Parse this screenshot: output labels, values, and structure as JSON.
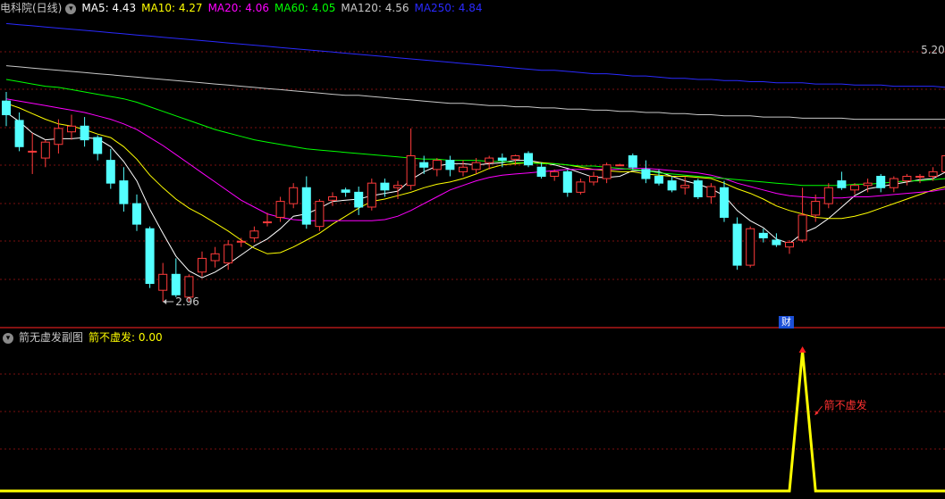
{
  "main_header": {
    "title": "电科院(日线)",
    "ma_items": [
      {
        "label": "MA5: 4.43",
        "color": "#ffffff"
      },
      {
        "label": "MA10: 4.27",
        "color": "#ffff00"
      },
      {
        "label": "MA20: 4.06",
        "color": "#ff00ff"
      },
      {
        "label": "MA60: 4.05",
        "color": "#00ff00"
      },
      {
        "label": "MA120: 4.56",
        "color": "#c8c8c8"
      },
      {
        "label": "MA250: 4.84",
        "color": "#2a2aff"
      }
    ]
  },
  "sub_header": {
    "title": "箭无虚发副图",
    "value_label": "箭不虚发: 0.00",
    "value_color": "#ffff00"
  },
  "annotations": {
    "high_label": "5.20",
    "low_label": "2.96",
    "cai_badge": "财",
    "signal_label": "箭不虚发"
  },
  "colors": {
    "background": "#000000",
    "up": "#ff3b3b",
    "down": "#54ffff",
    "grid": "#7a1010",
    "separator": "#b01818",
    "signal_line": "#ffff00",
    "signal_label": "#ff3030"
  },
  "chart_data": [
    {
      "type": "candlestick",
      "title": "电科院(日线)",
      "ylim": [
        2.85,
        5.45
      ],
      "ohlc": [
        [
          4.72,
          4.8,
          4.5,
          4.6
        ],
        [
          4.55,
          4.62,
          4.28,
          4.32
        ],
        [
          4.28,
          4.44,
          4.08,
          4.28
        ],
        [
          4.22,
          4.38,
          4.14,
          4.36
        ],
        [
          4.34,
          4.56,
          4.26,
          4.48
        ],
        [
          4.45,
          4.6,
          4.38,
          4.5
        ],
        [
          4.5,
          4.58,
          4.32,
          4.38
        ],
        [
          4.4,
          4.42,
          4.2,
          4.26
        ],
        [
          4.2,
          4.3,
          3.95,
          4.0
        ],
        [
          4.02,
          4.14,
          3.75,
          3.82
        ],
        [
          3.82,
          3.9,
          3.58,
          3.64
        ],
        [
          3.6,
          3.62,
          3.08,
          3.12
        ],
        [
          3.06,
          3.3,
          2.96,
          3.2
        ],
        [
          3.2,
          3.34,
          3.0,
          3.02
        ],
        [
          3.0,
          3.2,
          2.96,
          3.18
        ],
        [
          3.22,
          3.4,
          3.18,
          3.34
        ],
        [
          3.32,
          3.44,
          3.26,
          3.38
        ],
        [
          3.3,
          3.5,
          3.24,
          3.46
        ],
        [
          3.49,
          3.52,
          3.44,
          3.49
        ],
        [
          3.52,
          3.62,
          3.48,
          3.58
        ],
        [
          3.66,
          3.74,
          3.62,
          3.66
        ],
        [
          3.7,
          3.88,
          3.66,
          3.84
        ],
        [
          3.82,
          4.0,
          3.78,
          3.96
        ],
        [
          3.96,
          4.06,
          3.6,
          3.64
        ],
        [
          3.62,
          3.86,
          3.58,
          3.84
        ],
        [
          3.85,
          3.92,
          3.8,
          3.88
        ],
        [
          3.94,
          3.96,
          3.88,
          3.92
        ],
        [
          3.92,
          3.97,
          3.72,
          3.79
        ],
        [
          3.79,
          4.04,
          3.76,
          4.0
        ],
        [
          4.0,
          4.04,
          3.88,
          3.94
        ],
        [
          3.96,
          4.02,
          3.86,
          3.98
        ],
        [
          3.98,
          4.48,
          3.94,
          4.24
        ],
        [
          4.18,
          4.24,
          4.08,
          4.14
        ],
        [
          4.12,
          4.22,
          4.06,
          4.2
        ],
        [
          4.2,
          4.24,
          4.06,
          4.12
        ],
        [
          4.1,
          4.2,
          4.06,
          4.14
        ],
        [
          4.12,
          4.22,
          4.08,
          4.18
        ],
        [
          4.18,
          4.24,
          4.12,
          4.22
        ],
        [
          4.22,
          4.26,
          4.14,
          4.2
        ],
        [
          4.21,
          4.25,
          4.16,
          4.24
        ],
        [
          4.26,
          4.28,
          4.14,
          4.16
        ],
        [
          4.14,
          4.18,
          4.04,
          4.06
        ],
        [
          4.06,
          4.12,
          4.02,
          4.1
        ],
        [
          4.1,
          4.12,
          3.88,
          3.92
        ],
        [
          3.92,
          4.04,
          3.9,
          4.01
        ],
        [
          4.01,
          4.1,
          3.98,
          4.06
        ],
        [
          4.04,
          4.18,
          4.0,
          4.16
        ],
        [
          4.16,
          4.17,
          4.15,
          4.16
        ],
        [
          4.24,
          4.26,
          4.12,
          4.14
        ],
        [
          4.12,
          4.2,
          4.0,
          4.04
        ],
        [
          4.06,
          4.12,
          3.98,
          4.0
        ],
        [
          4.02,
          4.06,
          3.92,
          3.94
        ],
        [
          3.96,
          4.06,
          3.9,
          3.98
        ],
        [
          4.02,
          4.04,
          3.86,
          3.88
        ],
        [
          3.88,
          4.0,
          3.82,
          3.97
        ],
        [
          3.96,
          4.02,
          3.66,
          3.7
        ],
        [
          3.64,
          3.7,
          3.24,
          3.28
        ],
        [
          3.28,
          3.62,
          3.26,
          3.6
        ],
        [
          3.56,
          3.6,
          3.48,
          3.52
        ],
        [
          3.5,
          3.56,
          3.44,
          3.46
        ],
        [
          3.44,
          3.5,
          3.38,
          3.48
        ],
        [
          3.5,
          3.96,
          3.48,
          3.72
        ],
        [
          3.72,
          3.9,
          3.66,
          3.84
        ],
        [
          3.82,
          4.0,
          3.78,
          3.96
        ],
        [
          4.02,
          4.1,
          3.94,
          3.96
        ],
        [
          3.94,
          4.0,
          3.9,
          3.98
        ],
        [
          3.98,
          4.04,
          3.92,
          4.0
        ],
        [
          4.06,
          4.08,
          3.92,
          3.96
        ],
        [
          3.96,
          4.06,
          3.92,
          4.04
        ],
        [
          4.02,
          4.08,
          3.98,
          4.06
        ],
        [
          4.06,
          4.08,
          4.0,
          4.06
        ],
        [
          4.06,
          4.14,
          4.02,
          4.1
        ],
        [
          4.1,
          4.3,
          4.08,
          4.24
        ],
        [
          4.26,
          5.2,
          4.22,
          4.92
        ]
      ],
      "ma_series": {
        "MA5": [
          4.62,
          4.54,
          4.44,
          4.38,
          4.39,
          4.39,
          4.4,
          4.39,
          4.32,
          4.19,
          4.02,
          3.77,
          3.56,
          3.36,
          3.23,
          3.17,
          3.22,
          3.29,
          3.37,
          3.45,
          3.51,
          3.6,
          3.71,
          3.73,
          3.78,
          3.84,
          3.85,
          3.86,
          3.89,
          3.91,
          3.93,
          4.03,
          4.1,
          4.15,
          4.17,
          4.17,
          4.16,
          4.17,
          4.18,
          4.2,
          4.2,
          4.18,
          4.16,
          4.13,
          4.09,
          4.05,
          4.05,
          4.06,
          4.11,
          4.11,
          4.1,
          4.06,
          4.02,
          3.99,
          3.95,
          3.89,
          3.76,
          3.67,
          3.61,
          3.51,
          3.47,
          3.56,
          3.61,
          3.69,
          3.79,
          3.89,
          3.95,
          3.97,
          3.99,
          4.01,
          4.03,
          4.04,
          4.1,
          4.26
        ],
        "MA10": [
          4.7,
          4.66,
          4.61,
          4.56,
          4.52,
          4.5,
          4.47,
          4.43,
          4.4,
          4.32,
          4.21,
          4.07,
          3.96,
          3.86,
          3.78,
          3.72,
          3.65,
          3.58,
          3.5,
          3.43,
          3.38,
          3.39,
          3.44,
          3.5,
          3.56,
          3.64,
          3.71,
          3.78,
          3.84,
          3.86,
          3.89,
          3.92,
          3.96,
          3.99,
          4.01,
          4.04,
          4.08,
          4.13,
          4.16,
          4.17,
          4.18,
          4.18,
          4.17,
          4.16,
          4.14,
          4.12,
          4.11,
          4.1,
          4.1,
          4.08,
          4.07,
          4.06,
          4.06,
          4.05,
          4.04,
          4.0,
          3.95,
          3.91,
          3.86,
          3.8,
          3.76,
          3.73,
          3.7,
          3.69,
          3.69,
          3.71,
          3.74,
          3.78,
          3.82,
          3.86,
          3.9,
          3.94,
          3.97,
          4.02
        ],
        "MA20": [
          4.74,
          4.72,
          4.7,
          4.68,
          4.66,
          4.64,
          4.62,
          4.59,
          4.56,
          4.52,
          4.47,
          4.4,
          4.33,
          4.25,
          4.17,
          4.09,
          4.01,
          3.93,
          3.85,
          3.79,
          3.73,
          3.7,
          3.68,
          3.67,
          3.67,
          3.67,
          3.67,
          3.67,
          3.67,
          3.68,
          3.71,
          3.76,
          3.82,
          3.88,
          3.94,
          3.98,
          4.02,
          4.05,
          4.07,
          4.08,
          4.09,
          4.1,
          4.11,
          4.12,
          4.12,
          4.12,
          4.12,
          4.12,
          4.13,
          4.13,
          4.12,
          4.11,
          4.1,
          4.09,
          4.07,
          4.04,
          4.0,
          3.97,
          3.94,
          3.91,
          3.89,
          3.88,
          3.87,
          3.87,
          3.87,
          3.88,
          3.88,
          3.89,
          3.9,
          3.91,
          3.92,
          3.93,
          3.95,
          3.98
        ],
        "MA60": [
          4.91,
          4.89,
          4.87,
          4.85,
          4.84,
          4.82,
          4.8,
          4.78,
          4.76,
          4.74,
          4.71,
          4.67,
          4.63,
          4.59,
          4.55,
          4.51,
          4.47,
          4.44,
          4.41,
          4.38,
          4.36,
          4.34,
          4.32,
          4.3,
          4.29,
          4.28,
          4.27,
          4.26,
          4.25,
          4.24,
          4.23,
          4.22,
          4.21,
          4.21,
          4.2,
          4.2,
          4.2,
          4.19,
          4.19,
          4.18,
          4.18,
          4.17,
          4.17,
          4.16,
          4.15,
          4.15,
          4.14,
          4.13,
          4.12,
          4.11,
          4.09,
          4.08,
          4.07,
          4.06,
          4.05,
          4.04,
          4.03,
          4.02,
          4.01,
          4.0,
          3.99,
          3.98,
          3.98,
          3.98,
          3.98,
          3.99,
          3.99,
          4.0,
          4.01,
          4.02,
          4.02,
          4.03,
          4.04,
          4.05
        ],
        "MA120": [
          5.03,
          5.02,
          5.01,
          5.0,
          4.99,
          4.98,
          4.97,
          4.96,
          4.95,
          4.94,
          4.93,
          4.92,
          4.91,
          4.9,
          4.89,
          4.88,
          4.87,
          4.86,
          4.85,
          4.84,
          4.83,
          4.82,
          4.81,
          4.8,
          4.79,
          4.78,
          4.77,
          4.77,
          4.76,
          4.75,
          4.74,
          4.73,
          4.72,
          4.71,
          4.7,
          4.7,
          4.69,
          4.68,
          4.68,
          4.67,
          4.67,
          4.66,
          4.66,
          4.65,
          4.65,
          4.64,
          4.64,
          4.63,
          4.63,
          4.62,
          4.62,
          4.61,
          4.61,
          4.6,
          4.6,
          4.59,
          4.59,
          4.59,
          4.58,
          4.58,
          4.58,
          4.57,
          4.57,
          4.57,
          4.57,
          4.56,
          4.56,
          4.56,
          4.56,
          4.56,
          4.56,
          4.56,
          4.56,
          4.56
        ],
        "MA250": [
          5.4,
          5.39,
          5.38,
          5.37,
          5.36,
          5.35,
          5.34,
          5.33,
          5.32,
          5.31,
          5.3,
          5.29,
          5.28,
          5.27,
          5.26,
          5.25,
          5.24,
          5.23,
          5.22,
          5.21,
          5.2,
          5.19,
          5.18,
          5.17,
          5.16,
          5.15,
          5.14,
          5.13,
          5.12,
          5.11,
          5.1,
          5.09,
          5.08,
          5.07,
          5.06,
          5.05,
          5.04,
          5.03,
          5.02,
          5.01,
          5.0,
          4.99,
          4.99,
          4.98,
          4.97,
          4.96,
          4.96,
          4.95,
          4.94,
          4.94,
          4.93,
          4.92,
          4.92,
          4.91,
          4.91,
          4.9,
          4.9,
          4.89,
          4.89,
          4.88,
          4.88,
          4.88,
          4.87,
          4.87,
          4.87,
          4.86,
          4.86,
          4.86,
          4.85,
          4.85,
          4.85,
          4.85,
          4.84,
          4.84
        ]
      }
    },
    {
      "type": "line",
      "title": "箭无虚发副图",
      "series": [
        {
          "name": "箭不虚发",
          "values": [
            0,
            0,
            0,
            0,
            0,
            0,
            0,
            0,
            0,
            0,
            0,
            0,
            0,
            0,
            0,
            0,
            0,
            0,
            0,
            0,
            0,
            0,
            0,
            0,
            0,
            0,
            0,
            0,
            0,
            0,
            0,
            0,
            0,
            0,
            0,
            0,
            0,
            0,
            0,
            0,
            0,
            0,
            0,
            0,
            0,
            0,
            0,
            0,
            0,
            0,
            0,
            0,
            0,
            0,
            0,
            0,
            0,
            0,
            0,
            0,
            0,
            1,
            0,
            0,
            0,
            0,
            0,
            0,
            0,
            0,
            0,
            0,
            0,
            0
          ]
        }
      ],
      "ylim": [
        0,
        1
      ]
    }
  ]
}
